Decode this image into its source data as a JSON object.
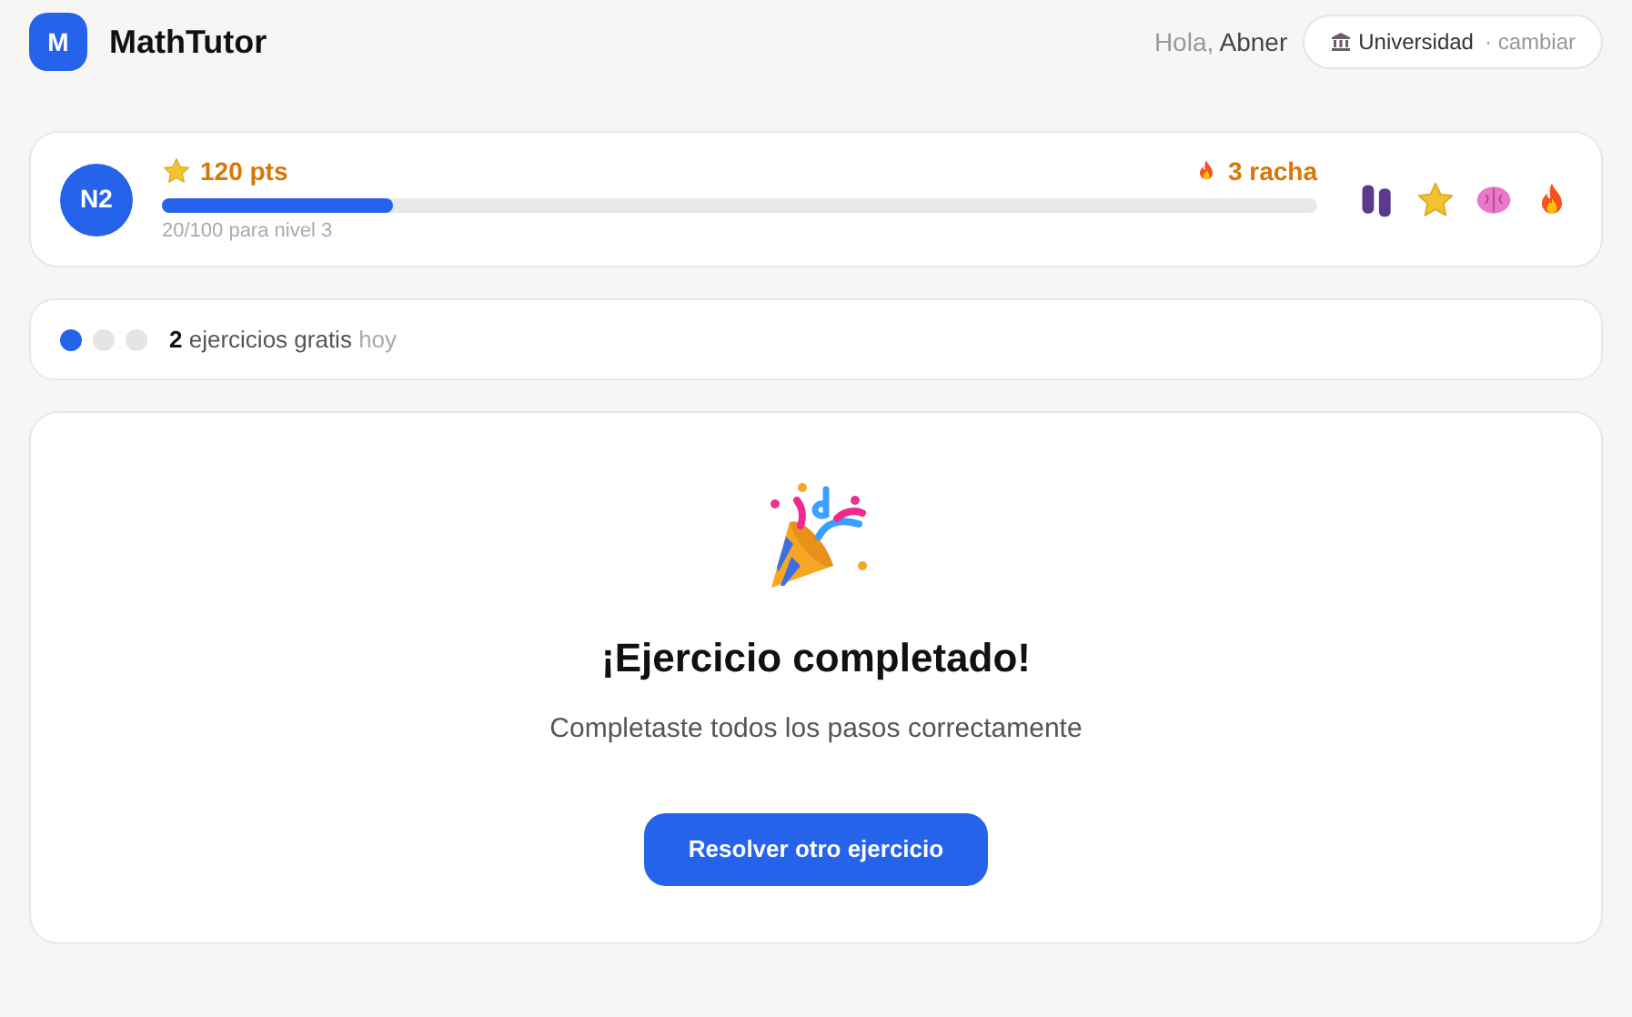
{
  "header": {
    "logo_letter": "M",
    "app_name": "MathTutor",
    "greeting": "Hola,",
    "user_name": "Abner",
    "level_button": {
      "label": "Universidad",
      "action": "· cambiar"
    }
  },
  "progress": {
    "level_badge": "N2",
    "points": "120 pts",
    "streak": "3 racha",
    "level": 0.2,
    "caption": "20/100 para nivel 3"
  },
  "free_exercises": {
    "dots": [
      {
        "filled": true
      },
      {
        "filled": false
      },
      {
        "filled": false
      }
    ],
    "count": "2",
    "label": "ejercicios gratis",
    "suffix": "hoy"
  },
  "completion": {
    "title": "¡Ejercicio completado!",
    "message": "Completaste todos los pasos correctamente",
    "button": "Resolver otro ejercicio"
  }
}
